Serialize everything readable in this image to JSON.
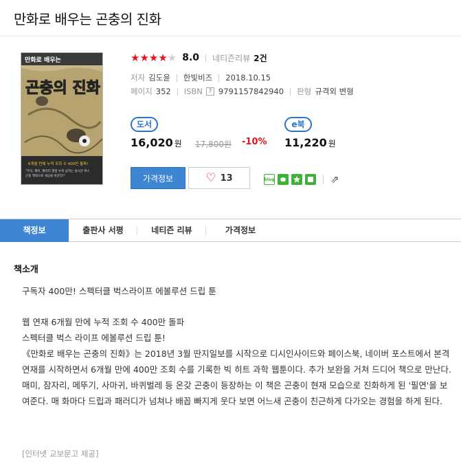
{
  "book": {
    "title": "만화로 배우는 곤충의 진화",
    "stars_filled": 4,
    "stars_total": 5,
    "score": "8.0",
    "review_label": "네티즌리뷰",
    "review_count": "2건",
    "author_label": "저자",
    "author": "김도윤",
    "publisher": "한빛비즈",
    "date": "2018.10.15",
    "pages_label": "페이지",
    "pages": "352",
    "isbn_label": "ISBN",
    "isbn_q": "?",
    "isbn": "9791157842940",
    "format_label": "판형",
    "format": "규격외 변형"
  },
  "cover": {
    "top_line": "만화로 배우는",
    "big_title": "곤충의 진화",
    "caption": "6개월 만에 누적 조회 수 400만 돌파!",
    "blurb1": "\"무식, 재미, 퀄리티 열정 누적 넘치는 실시간 버스",
    "blurb2": "곤충 맥락으로 세상을 바꾼다!\""
  },
  "pricing": {
    "paper_label": "도서",
    "paper_price": "16,020",
    "won": "원",
    "paper_orig": "17,800원",
    "discount": "-10%",
    "ebook_label": "e북",
    "ebook_price": "11,220"
  },
  "actions": {
    "price_info": "가격정보",
    "heart": "♡",
    "like_count": "13",
    "blog": "blog",
    "share_arrow": "⇗"
  },
  "tabs": [
    "책정보",
    "출판사 서평",
    "네티즌 리뷰",
    "가격정보"
  ],
  "section": {
    "title": "책소개",
    "p1": "구독자 400만! 스펙터클 벅스라이프 에볼루션 드립 툰",
    "p2": "웹 연재 6개월 만에 누적 조회 수 400만 돌파",
    "p3": "스펙터클 벅스 라이프 에볼루션 드립 툰!",
    "p4": "《만화로 배우는 곤충의 진화》는 2018년 3월 딴지일보를 시작으로 디시인사이드와 페이스북, 네이버 포스트에서 본격 연재를 시작하면서 6개월 만에 400만 조회 수를 기록한 빅 히트 과학 웹툰이다. 추가 보완을 거쳐 드디어 책으로 만난다.",
    "p5": "매미, 잠자리, 메뚜기, 사마귀, 바퀴벌레 등 온갖 곤충이 등장하는 이 책은 곤충이 현재 모습으로 진화하게 된 '필연'을 보여준다. 매 화마다 드립과 패러디가 넘쳐나 배꼽 빠지게 웃다 보면 어느새 곤충이 친근하게 다가오는 경험을 하게 된다.",
    "source": "[인터넷 교보문고 제공]"
  },
  "colors": {
    "accent": "#3e85d3",
    "star": "#e4141d",
    "sale": "#e4141d"
  }
}
